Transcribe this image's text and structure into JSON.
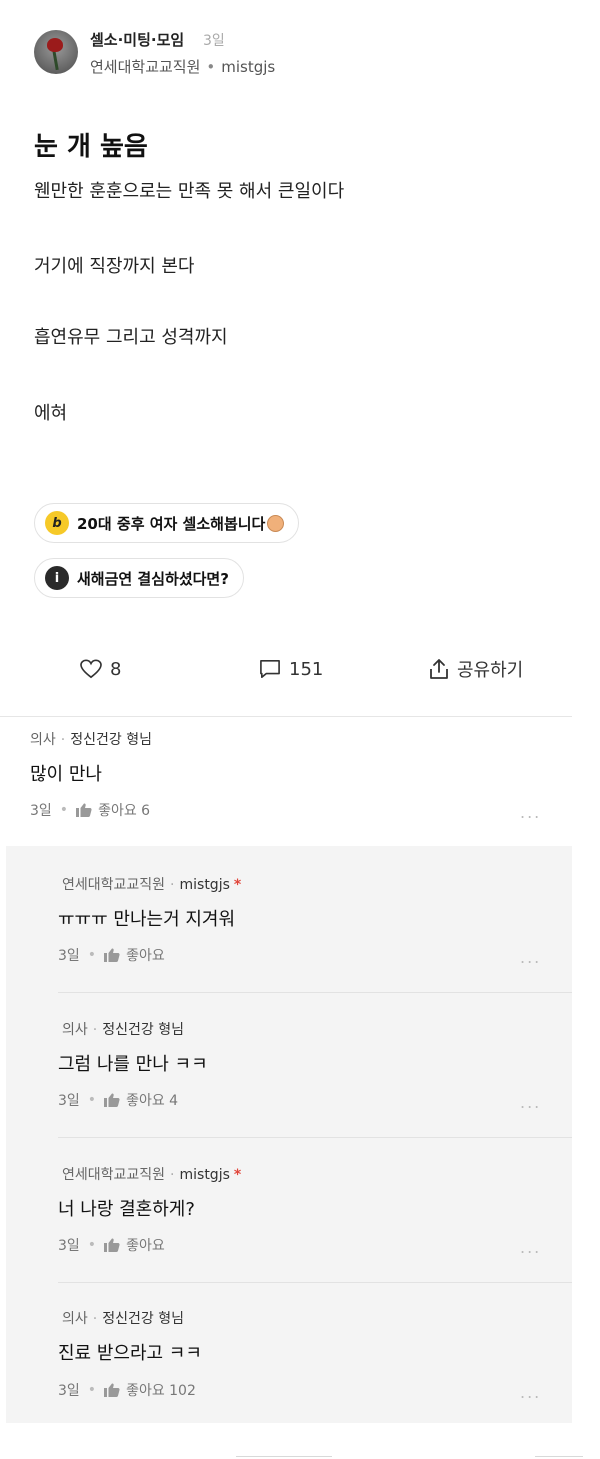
{
  "post": {
    "board": "셀소·미팅·모임",
    "time": "3일",
    "company": "연세대학교교직원",
    "nickname": "mistgjs",
    "title": "눈 개 높음",
    "lines": [
      "웬만한 훈훈으로는 만족 못 해서 큰일이다",
      "거기에 직장까지 본다",
      "흡연유무 그리고 성격까지",
      "에혀"
    ]
  },
  "chips": [
    {
      "icon": "b",
      "text": "20대 중후 여자 셀소해봅니다"
    },
    {
      "icon": "i",
      "text": "새해금연 결심하셨다면?"
    }
  ],
  "actions": {
    "likes": "8",
    "comments": "151",
    "share": "공유하기"
  },
  "comments": [
    {
      "company": "의사",
      "nick": "정신건강 형님",
      "text": "많이 만나",
      "time": "3일",
      "like_label": "좋아요 6"
    },
    {
      "company": "연세대학교교직원",
      "nick": "mistgjs",
      "author": "*",
      "text": "ㅠㅠㅠ 만나는거 지겨워",
      "time": "3일",
      "like_label": "좋아요"
    },
    {
      "company": "의사",
      "nick": "정신건강 형님",
      "text": "그럼 나를 만나 ㅋㅋ",
      "time": "3일",
      "like_label": "좋아요 4"
    },
    {
      "company": "연세대학교교직원",
      "nick": "mistgjs",
      "author": "*",
      "text": "너 나랑 결혼하게?",
      "time": "3일",
      "like_label": "좋아요"
    },
    {
      "company": "의사",
      "nick": "정신건강 형님",
      "text": "진료 받으라고 ㅋㅋ",
      "time": "3일",
      "like_label": "좋아요 102"
    }
  ],
  "ui": {
    "dot": "•",
    "meta_sep": "·",
    "more": "..."
  },
  "colors": {
    "author_star": "#e0453a",
    "chip_b": "#f6c928",
    "reply_bg": "#f4f4f4"
  }
}
